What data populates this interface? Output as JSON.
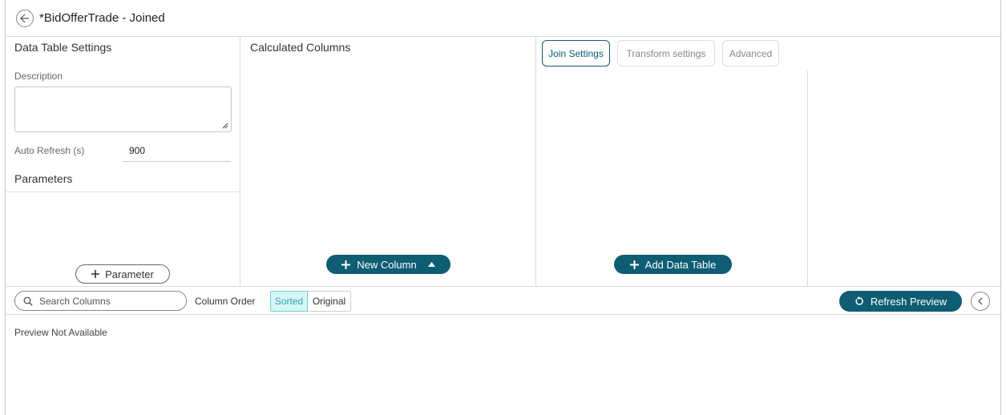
{
  "header": {
    "title": "*BidOfferTrade - Joined",
    "back_icon": "arrow-left-icon"
  },
  "left_panel": {
    "title": "Data Table Settings",
    "description_label": "Description",
    "description_value": "",
    "auto_refresh_label": "Auto Refresh (s)",
    "auto_refresh_value": "900",
    "parameters_title": "Parameters",
    "add_parameter_label": "Parameter"
  },
  "calc_panel": {
    "title": "Calculated Columns",
    "new_column_label": "New Column"
  },
  "join_panel": {
    "tabs": [
      {
        "label": "Join Settings",
        "active": true
      },
      {
        "label": "Transform settings",
        "active": false
      },
      {
        "label": "Advanced",
        "active": false
      }
    ],
    "add_table_label": "Add Data Table"
  },
  "toolbar": {
    "search_placeholder": "Search Columns",
    "column_order_label": "Column Order",
    "sorted_label": "Sorted",
    "original_label": "Original",
    "refresh_label": "Refresh Preview"
  },
  "preview": {
    "message": "Preview Not Available"
  },
  "colors": {
    "primary": "#0e5d73",
    "sorted_bg": "#d9f6f7",
    "sorted_text": "#2aa7b0"
  }
}
